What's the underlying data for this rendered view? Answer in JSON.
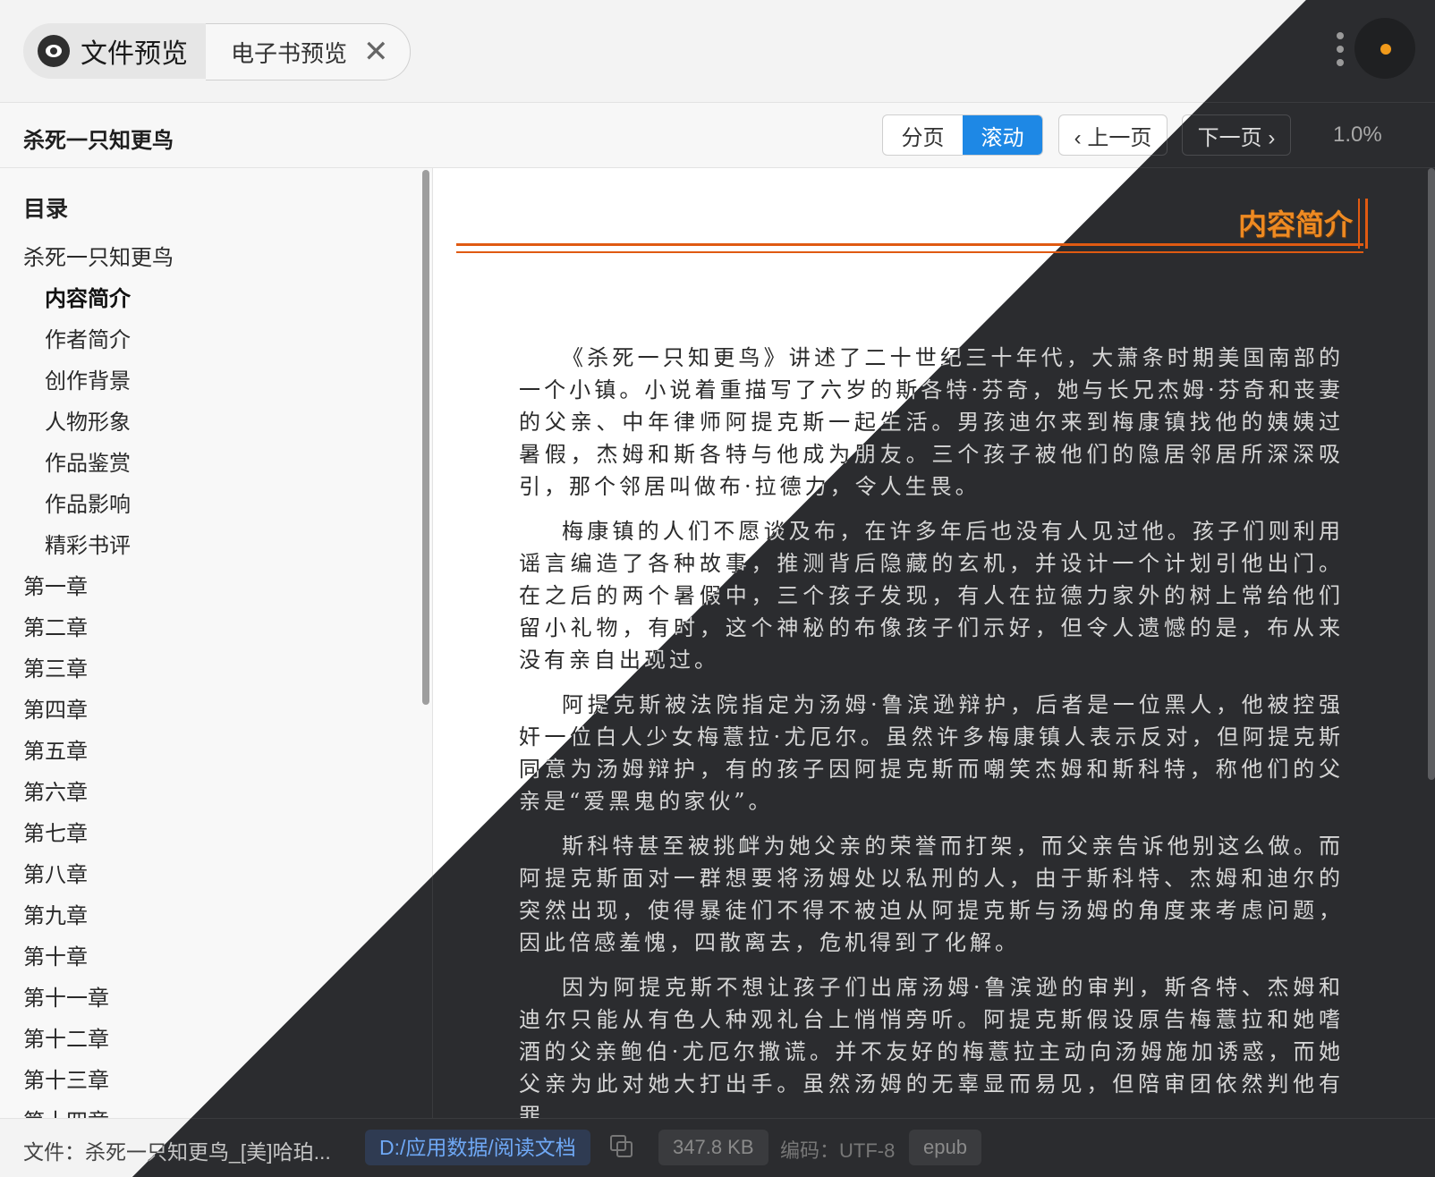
{
  "window": {
    "app_tab_label": "文件预览",
    "doc_tab_label": "电子书预览",
    "close_glyph": "✕"
  },
  "toolbar": {
    "book_title": "杀死一只知更鸟",
    "mode_page": "分页",
    "mode_scroll": "滚动",
    "active_mode": "滚动",
    "prev_label": "‹ 上一页",
    "next_label": "下一页 ›",
    "progress": "1.0%"
  },
  "sidebar": {
    "heading": "目录",
    "items": [
      {
        "label": "杀死一只知更鸟",
        "level": 1
      },
      {
        "label": "内容简介",
        "level": 2,
        "active": true
      },
      {
        "label": "作者简介",
        "level": 2
      },
      {
        "label": "创作背景",
        "level": 2
      },
      {
        "label": "人物形象",
        "level": 2
      },
      {
        "label": "作品鉴赏",
        "level": 2
      },
      {
        "label": "作品影响",
        "level": 2
      },
      {
        "label": "精彩书评",
        "level": 2
      },
      {
        "label": "第一章",
        "level": 1
      },
      {
        "label": "第二章",
        "level": 1
      },
      {
        "label": "第三章",
        "level": 1
      },
      {
        "label": "第四章",
        "level": 1
      },
      {
        "label": "第五章",
        "level": 1
      },
      {
        "label": "第六章",
        "level": 1
      },
      {
        "label": "第七章",
        "level": 1
      },
      {
        "label": "第八章",
        "level": 1
      },
      {
        "label": "第九章",
        "level": 1
      },
      {
        "label": "第十章",
        "level": 1
      },
      {
        "label": "第十一章",
        "level": 1
      },
      {
        "label": "第十二章",
        "level": 1
      },
      {
        "label": "第十三章",
        "level": 1
      },
      {
        "label": "第十四章",
        "level": 1
      }
    ]
  },
  "reader": {
    "chapter_title": "内容简介",
    "paragraphs": [
      "《杀死一只知更鸟》讲述了二十世纪三十年代，大萧条时期美国南部的一个小镇。小说着重描写了六岁的斯各特·芬奇，她与长兄杰姆·芬奇和丧妻的父亲、中年律师阿提克斯一起生活。男孩迪尔来到梅康镇找他的姨姨过暑假，杰姆和斯各特与他成为朋友。三个孩子被他们的隐居邻居所深深吸引，那个邻居叫做布·拉德力，令人生畏。",
      "梅康镇的人们不愿谈及布，在许多年后也没有人见过他。孩子们则利用谣言编造了各种故事，推测背后隐藏的玄机，并设计一个计划引他出门。在之后的两个暑假中，三个孩子发现，有人在拉德力家外的树上常给他们留小礼物，有时，这个神秘的布像孩子们示好，但令人遗憾的是，布从来没有亲自出现过。",
      "阿提克斯被法院指定为汤姆·鲁滨逊辩护，后者是一位黑人，他被控强奸一位白人少女梅薏拉·尤厄尔。虽然许多梅康镇人表示反对，但阿提克斯同意为汤姆辩护，有的孩子因阿提克斯而嘲笑杰姆和斯科特，称他们的父亲是“爱黑鬼的家伙”。",
      "斯科特甚至被挑衅为她父亲的荣誉而打架，而父亲告诉他别这么做。而阿提克斯面对一群想要将汤姆处以私刑的人，由于斯科特、杰姆和迪尔的突然出现，使得暴徒们不得不被迫从阿提克斯与汤姆的角度来考虑问题，因此倍感羞愧，四散离去，危机得到了化解。",
      "因为阿提克斯不想让孩子们出席汤姆·鲁滨逊的审判，斯各特、杰姆和迪尔只能从有色人种观礼台上悄悄旁听。阿提克斯假设原告梅薏拉和她嗜酒的父亲鲍伯·尤厄尔撒谎。并不友好的梅薏拉主动向汤姆施加诱惑，而她父亲为此对她大打出手。虽然汤姆的无辜显而易见，但陪审团依然判他有罪。"
    ]
  },
  "status": {
    "file_label": "文件：杀死一只知更鸟_[美]哈珀...",
    "path": "D:/应用数据/阅读文档",
    "size": "347.8 KB",
    "encoding": "编码：UTF-8",
    "type": "epub"
  },
  "colors": {
    "accent_blue": "#1e88e5",
    "chapter_orange": "#ee8a22",
    "rule_orange": "#e05a12",
    "dark_bg": "#2b2c2f"
  }
}
